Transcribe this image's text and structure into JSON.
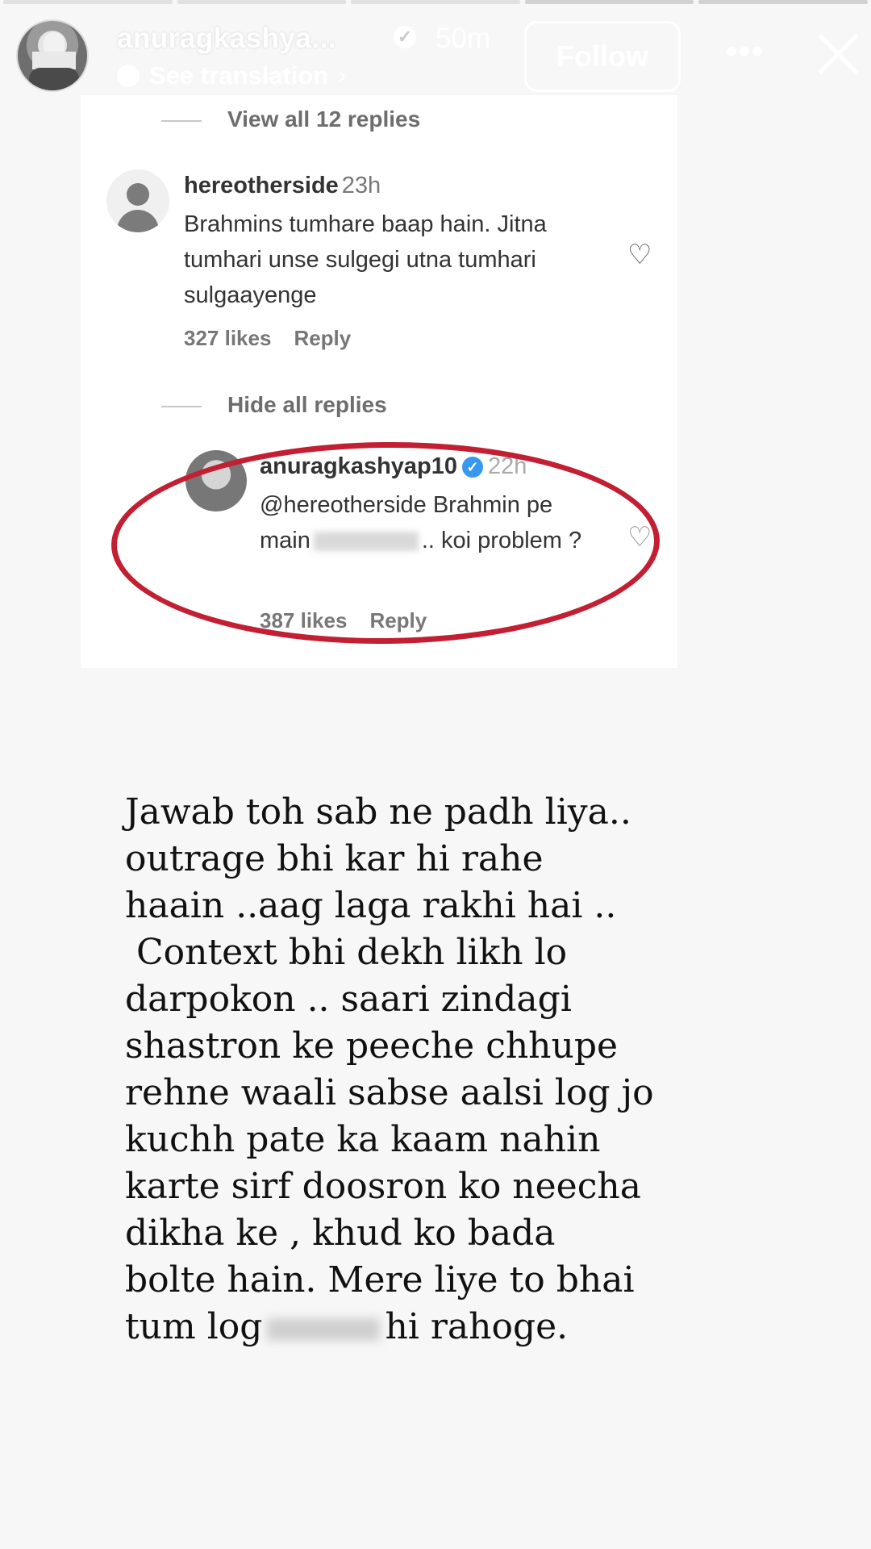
{
  "header": {
    "username": "anuragkashya...",
    "time": "50m",
    "translation": "See translation",
    "follow_label": "Follow",
    "more_label": "•••"
  },
  "comment": {
    "view_all": "View all 12 replies",
    "username": "hereotherside",
    "time": "23h",
    "text": "Brahmins tumhare baap hain. Jitna tumhari unse sulgegi utna tumhari sulgaayenge",
    "likes": "327 likes",
    "reply": "Reply",
    "hide_all": "Hide all replies"
  },
  "reply": {
    "username": "anuragkashyap10",
    "time": "22h",
    "text_part1": "@hereotherside Brahmin pe main",
    "text_part2": ".. koi problem ?",
    "likes": "387 likes",
    "reply": "Reply"
  },
  "story_text": {
    "before_blur": "Jawab toh sab ne padh liya..\noutrage bhi kar hi rahe\nhaain ..aag laga rakhi hai ..\n Context bhi dekh likh lo\ndarpokon .. saari zindagi\nshastron ke peeche chhupe\nrehne waali sabse aalsi log jo\nkuchh pate ka kaam nahin\nkarte sirf doosron ko neecha\ndikha ke , khud ko bada\nbolte hain. Mere liye to bhai\ntum log",
    "after_blur": "hi rahoge."
  },
  "colors": {
    "circle_red": "#c31f33",
    "verified_blue": "#3897f0"
  }
}
